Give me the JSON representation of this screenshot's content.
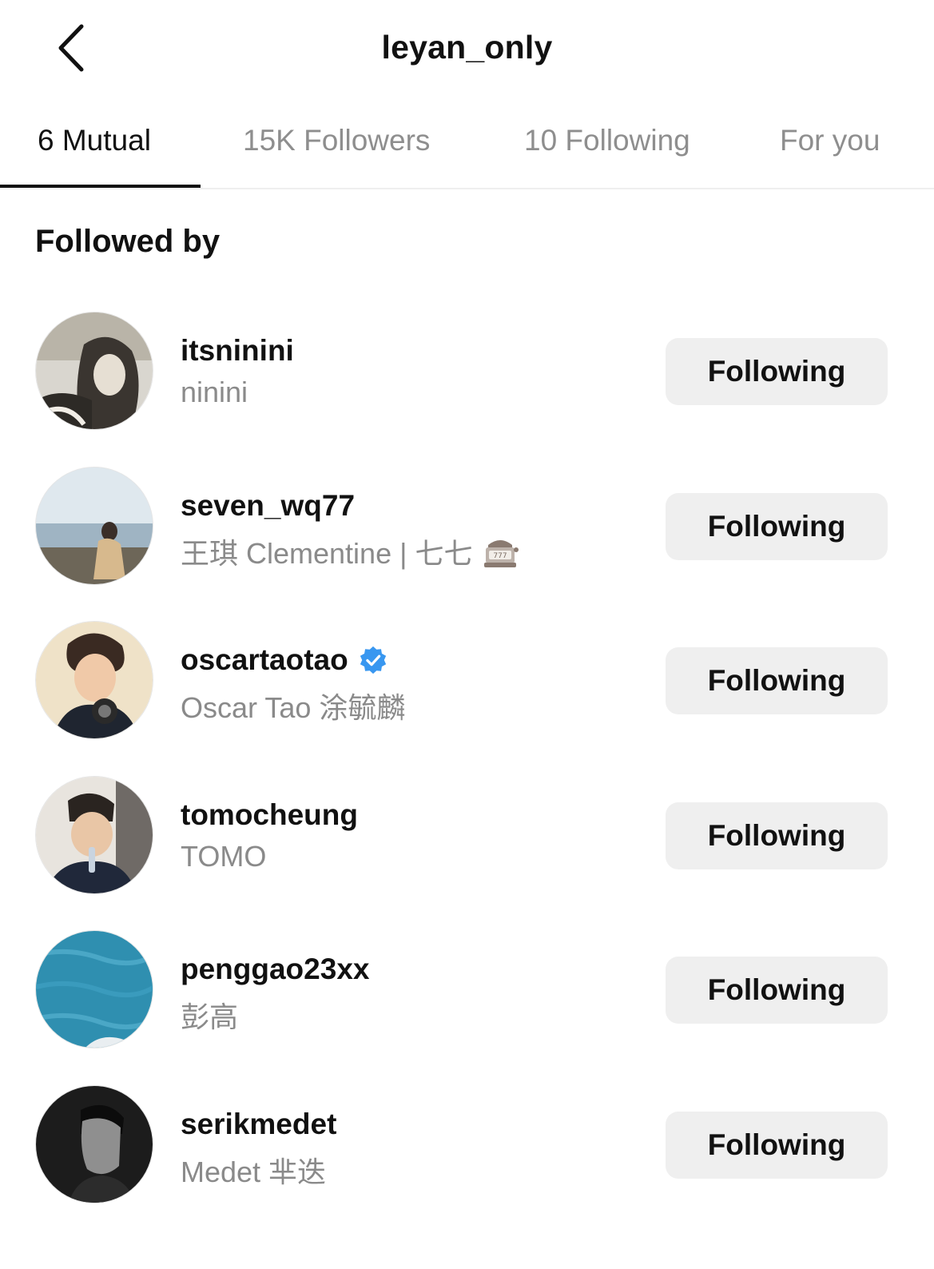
{
  "header": {
    "title": "leyan_only",
    "back_icon": "chevron-left-icon"
  },
  "tabs": [
    {
      "label": "6 Mutual",
      "active": true
    },
    {
      "label": "15K Followers",
      "active": false
    },
    {
      "label": "10 Following",
      "active": false
    },
    {
      "label": "For you",
      "active": false
    }
  ],
  "section": {
    "heading": "Followed by"
  },
  "users": [
    {
      "username": "itsninini",
      "full_name": "ninini",
      "verified": false,
      "button_label": "Following"
    },
    {
      "username": "seven_wq77",
      "full_name": "王琪 Clementine | 七七",
      "name_emoji": "slot-machine-icon",
      "verified": false,
      "button_label": "Following"
    },
    {
      "username": "oscartaotao",
      "full_name": "Oscar Tao 涂毓麟",
      "verified": true,
      "button_label": "Following"
    },
    {
      "username": "tomocheung",
      "full_name": "TOMO",
      "verified": false,
      "button_label": "Following"
    },
    {
      "username": "penggao23xx",
      "full_name": "彭高",
      "verified": false,
      "button_label": "Following"
    },
    {
      "username": "serikmedet",
      "full_name": "Medet 芈迭",
      "verified": false,
      "button_label": "Following"
    }
  ],
  "colors": {
    "text_primary": "#111111",
    "text_secondary": "#8a8a8a",
    "button_bg": "#efefef",
    "verified_blue": "#3897f0"
  }
}
